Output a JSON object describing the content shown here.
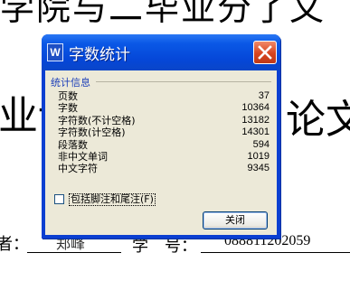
{
  "document": {
    "top_line": "学院与二毕业分了文",
    "big_left": "业论",
    "big_right": "论文",
    "bottom_label": "者：",
    "bottom_name": "郑峰",
    "bottom_xue": "学　号：",
    "bottom_number": "088811202059"
  },
  "dialog": {
    "title": "字数统计",
    "group_label": "统计信息",
    "stats": [
      {
        "label": "页数",
        "value": "37"
      },
      {
        "label": "字数",
        "value": "10364"
      },
      {
        "label": "字符数(不计空格)",
        "value": "13182"
      },
      {
        "label": "字符数(计空格)",
        "value": "14301"
      },
      {
        "label": "段落数",
        "value": "594"
      },
      {
        "label": "非中文单词",
        "value": "1019"
      },
      {
        "label": "中文字符",
        "value": "9345"
      }
    ],
    "checkbox_label": "包括脚注和尾注(F)",
    "checkbox_checked": false,
    "close_button_label": "关闭"
  },
  "colors": {
    "titlebar": "#0a58e6",
    "close_button": "#d8441f",
    "client_bg": "#ece9d8",
    "group_label": "#1c3fb8"
  }
}
